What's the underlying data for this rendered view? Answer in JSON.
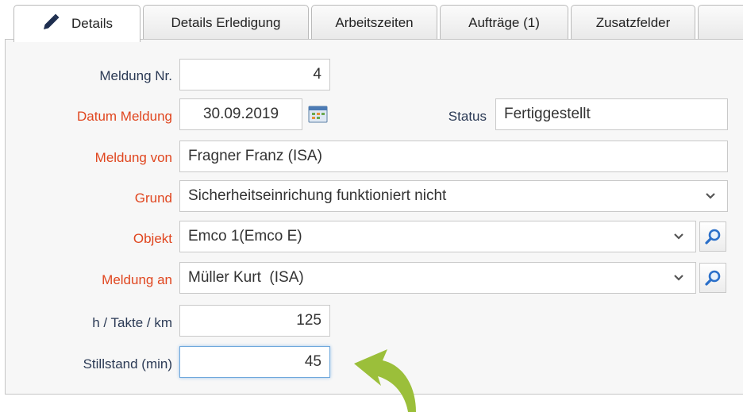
{
  "tabs": [
    {
      "label": "Details"
    },
    {
      "label": "Details Erledigung"
    },
    {
      "label": "Arbeitszeiten"
    },
    {
      "label": "Aufträge (1)"
    },
    {
      "label": "Zusatzfelder"
    }
  ],
  "form": {
    "meldung_nr": {
      "label": "Meldung Nr.",
      "value": "4"
    },
    "datum": {
      "label": "Datum Meldung",
      "value": "30.09.2019"
    },
    "status": {
      "label": "Status",
      "value": "Fertiggestellt"
    },
    "meldung_von": {
      "label": "Meldung von",
      "value": "Fragner Franz (ISA)"
    },
    "grund": {
      "label": "Grund",
      "value": "Sicherheitseinrichung funktioniert nicht"
    },
    "objekt": {
      "label": "Objekt",
      "value": "Emco 1(Emco E)"
    },
    "meldung_an": {
      "label": "Meldung an",
      "value": "Müller Kurt  (ISA)"
    },
    "takte": {
      "label": "h / Takte / km",
      "value": "125"
    },
    "stillstand": {
      "label": "Stillstand (min)",
      "value": "45"
    }
  },
  "colors": {
    "required_label": "#e0461f",
    "normal_label": "#2b3a55",
    "arrow": "#9bbf3a",
    "search_icon": "#2a6fc9"
  },
  "icons": {
    "tab_icon": "pencil-icon",
    "date_picker": "calendar-icon",
    "dropdown": "chevron-down-icon",
    "lookup": "search-icon",
    "annotation": "curved-arrow-icon"
  }
}
